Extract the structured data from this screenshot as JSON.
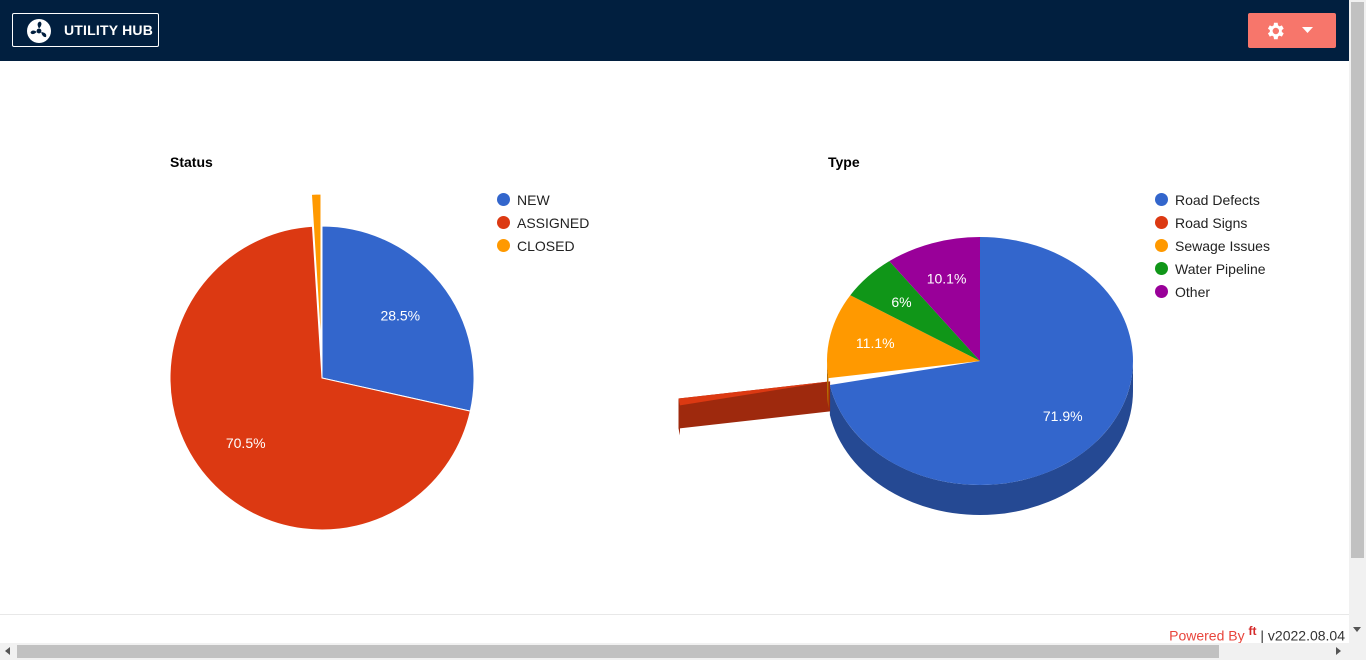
{
  "header": {
    "brand_label": "UTILITY HUB",
    "brand_icon": "fan-logo-icon",
    "settings_icon": "gear-icon",
    "navbar_color": "#011f3f",
    "settings_color": "#f7766b"
  },
  "chart_data": [
    {
      "type": "pie",
      "title": "Status",
      "categories": [
        "NEW",
        "ASSIGNED",
        "CLOSED"
      ],
      "values": [
        28.5,
        70.5,
        1.0
      ],
      "labels": [
        "28.5%",
        "70.5%",
        ""
      ],
      "colors": [
        "#3366cc",
        "#dc3912",
        "#ff9900"
      ],
      "exploded": [
        "CLOSED"
      ],
      "legend": "right"
    },
    {
      "type": "pie",
      "title": "Type",
      "categories": [
        "Road Defects",
        "Road Signs",
        "Sewage Issues",
        "Water Pipeline",
        "Other"
      ],
      "values": [
        71.9,
        0.9,
        11.1,
        6.0,
        10.1
      ],
      "labels": [
        "71.9%",
        "",
        "11.1%",
        "6%",
        "10.1%"
      ],
      "colors": [
        "#3366cc",
        "#dc3912",
        "#ff9900",
        "#109618",
        "#990099"
      ],
      "exploded": [
        "Road Signs"
      ],
      "is3D": true,
      "legend": "right"
    }
  ],
  "footer": {
    "powered_by": "Powered By",
    "separator": "|",
    "version": "v2022.08.04"
  }
}
